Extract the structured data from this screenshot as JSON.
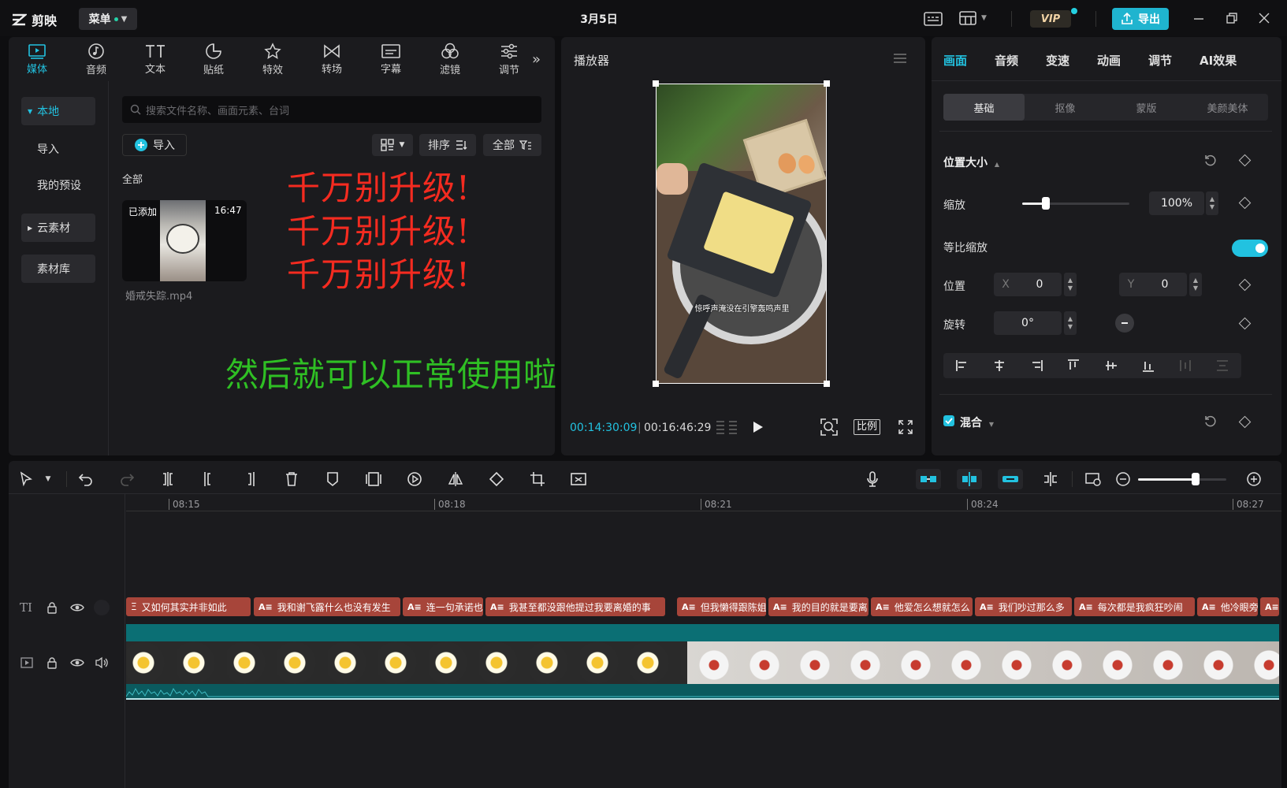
{
  "titlebar": {
    "app_name": "剪映",
    "menu_label": "菜单",
    "date": "3月5日",
    "vip_label": "VIP",
    "export_label": "导出"
  },
  "tool_tabs": [
    {
      "label": "媒体",
      "icon": "media-icon"
    },
    {
      "label": "音频",
      "icon": "audio-icon"
    },
    {
      "label": "文本",
      "icon": "text-icon"
    },
    {
      "label": "贴纸",
      "icon": "sticker-icon"
    },
    {
      "label": "特效",
      "icon": "effects-icon"
    },
    {
      "label": "转场",
      "icon": "transition-icon"
    },
    {
      "label": "字幕",
      "icon": "caption-icon"
    },
    {
      "label": "滤镜",
      "icon": "filter-icon"
    },
    {
      "label": "调节",
      "icon": "adjust-icon"
    }
  ],
  "side_nav": {
    "local": "本地",
    "import": "导入",
    "presets": "我的预设",
    "cloud": "云素材",
    "library": "素材库"
  },
  "media": {
    "search_placeholder": "搜索文件名称、画面元素、台词",
    "import_label": "导入",
    "sort_label": "排序",
    "filter_label": "全部",
    "section_label": "全部",
    "thumb_badge": "已添加",
    "thumb_duration": "16:47",
    "thumb_filename": "婚戒失踪.mp4"
  },
  "overlay": {
    "red_line_1": "千万别升级!",
    "red_line_2": "千万别升级!",
    "red_line_3": "千万别升级!",
    "green_line": "然后就可以正常使用啦"
  },
  "player": {
    "title": "播放器",
    "caption": "惊呼声淹没在引擎轰鸣声里",
    "current_time": "00:14:30:09",
    "total_time": "00:16:46:29",
    "ratio_label": "比例"
  },
  "inspector": {
    "tabs": [
      "画面",
      "音频",
      "变速",
      "动画",
      "调节",
      "AI效果"
    ],
    "subtabs": [
      "基础",
      "抠像",
      "蒙版",
      "美颜美体"
    ],
    "section_position": "位置大小",
    "scale_label": "缩放",
    "scale_value": "100%",
    "scale_level": 0.22,
    "uniform_label": "等比缩放",
    "position_label": "位置",
    "x_label": "X",
    "x_value": "0",
    "y_label": "Y",
    "y_value": "0",
    "rotate_label": "旋转",
    "rotate_value": "0°",
    "blend_label": "混合"
  },
  "timeline": {
    "ruler": [
      "08:15",
      "08:18",
      "08:21",
      "08:24",
      "08:27"
    ],
    "zoom_level": 0.65,
    "subtitles": [
      "又如何其实并非如此",
      "我和谢飞露什么也没有发生",
      "连一句承诺也",
      "我甚至都没跟他提过我要离婚的事",
      "但我懒得跟陈姐",
      "我的目的就是要离",
      "他爱怎么想就怎么",
      "我们吵过那么多",
      "每次都是我疯狂吵闹",
      "他冷眼旁",
      ""
    ]
  }
}
